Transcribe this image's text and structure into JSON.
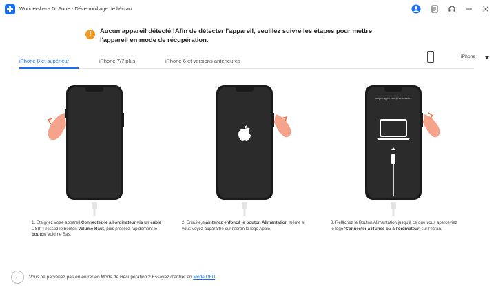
{
  "window": {
    "title": "Wondershare Dr.Fone - Déverrouillage de l'écran",
    "icons": [
      "app-logo-icon",
      "account-icon",
      "feedback-icon",
      "support-headset-icon",
      "minimize-icon",
      "close-icon"
    ]
  },
  "colors": {
    "accent": "#1a6ef5",
    "warning": "#f29a1f",
    "phone_body": "#1b1b1b",
    "hand": "#f5a38a"
  },
  "warning": {
    "icon": "exclamation-icon",
    "text_line1": "Aucun appareil détecté !Afin de détecter l'appareil, veuillez suivre les étapes pour mettre",
    "text_line2": "l'appareil en mode de récupération."
  },
  "tabs": [
    {
      "label": "iPhone 8 et supérieur",
      "active": true
    },
    {
      "label": "iPhone 7/7 plus",
      "active": false
    },
    {
      "label": "iPhone 6 et versions antérieures",
      "active": false
    }
  ],
  "device_select": {
    "value": "iPhone"
  },
  "steps": [
    {
      "screen": "blank",
      "text_a": "1. Eteignez votre appareil.",
      "text_b": "Connectez-le à l'ordinateur via un câble",
      "text_c": " USB. Pressez le bouton ",
      "text_d": "Volume Haut",
      "text_e": ", puis pressez rapidement le ",
      "text_f": "bouton",
      "text_g": " Volume Bas."
    },
    {
      "screen": "apple-logo",
      "text_a": "2. Ensuite,",
      "text_b": "maintenez enfoncé le bouton Alimentation",
      "text_c": " même si vous voyez apparaître sur l'écran le logo Apple."
    },
    {
      "screen": "connect-to-computer",
      "screen_caption": "support.apple.com/iphone/restore",
      "text_a": "3. Relâchez le Bouton Alimentation jusqu'à ce que vous aperceviez le logo ",
      "text_b": "'Connecter à iTunes ou à l'ordinateur'",
      "text_c": " sur l'écran."
    }
  ],
  "bottom": {
    "back_icon": "back-arrow-icon",
    "text": "Vous ne parvenez pas en entrer en Mode de Récupération ? Essayez d'entrer en ",
    "link": "Mode DFU",
    "suffix": "."
  }
}
